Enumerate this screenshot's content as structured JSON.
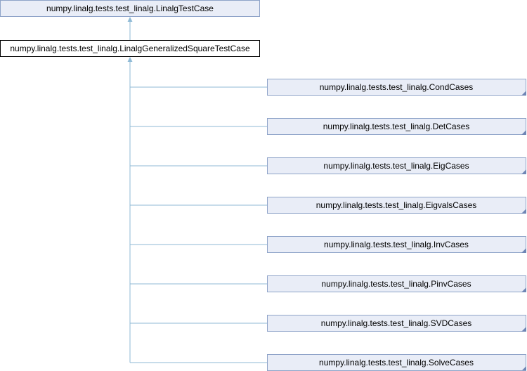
{
  "diagram": {
    "base": {
      "label": "numpy.linalg.tests.test_linalg.LinalgTestCase"
    },
    "current": {
      "label": "numpy.linalg.tests.test_linalg.LinalgGeneralizedSquareTestCase"
    },
    "children": [
      {
        "label": "numpy.linalg.tests.test_linalg.CondCases"
      },
      {
        "label": "numpy.linalg.tests.test_linalg.DetCases"
      },
      {
        "label": "numpy.linalg.tests.test_linalg.EigCases"
      },
      {
        "label": "numpy.linalg.tests.test_linalg.EigvalsCases"
      },
      {
        "label": "numpy.linalg.tests.test_linalg.InvCases"
      },
      {
        "label": "numpy.linalg.tests.test_linalg.PinvCases"
      },
      {
        "label": "numpy.linalg.tests.test_linalg.SVDCases"
      },
      {
        "label": "numpy.linalg.tests.test_linalg.SolveCases"
      }
    ],
    "colors": {
      "node_fill": "#e9edf7",
      "node_border": "#8ea3c8",
      "current_border": "#000000",
      "edge": "#8fbad6"
    }
  }
}
